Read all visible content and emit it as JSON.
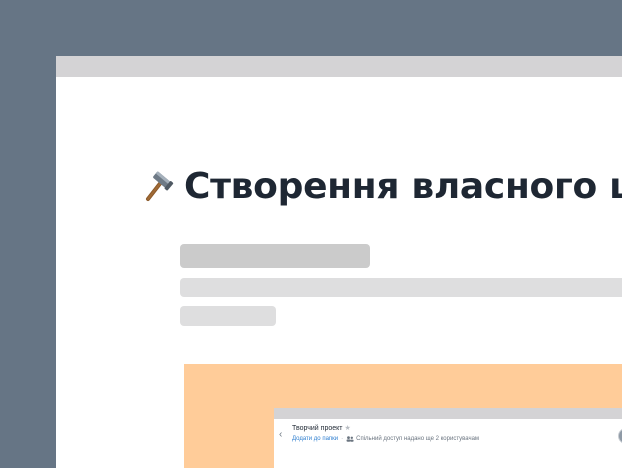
{
  "page": {
    "title": "Створення власного ша",
    "icon": "hammer-icon"
  },
  "preview": {
    "project_title": "Творчий проект",
    "star_icon": "star-icon",
    "add_to_folder": "Додати до папки",
    "separator": "·",
    "share_status": "Спільний доступ надано ще 2 користувачам",
    "back_icon": "chevron-left-icon",
    "users_icon": "users-icon"
  },
  "colors": {
    "background": "#667585",
    "window_bar": "#d4d3d5",
    "preview_background": "#ffcc99",
    "title_text": "#1e2733",
    "link": "#2f7fd0"
  }
}
